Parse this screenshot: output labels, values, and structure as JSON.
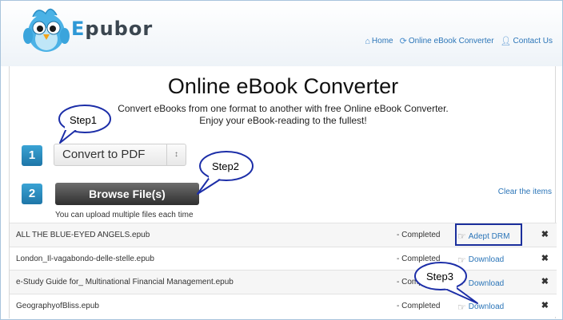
{
  "header": {
    "logo_text_first": "E",
    "logo_text_rest": "pubor",
    "nav": [
      {
        "label": "Home",
        "icon": "home-icon"
      },
      {
        "label": "Online eBook Converter",
        "icon": "refresh-icon"
      },
      {
        "label": "Contact Us",
        "icon": "user-icon"
      }
    ]
  },
  "main": {
    "title": "Online eBook Converter",
    "subtitle_line1": "Convert eBooks from one format to another with free Online eBook Converter.",
    "subtitle_line2": "Enjoy your eBook-reading to the fullest!",
    "step1_number": "1",
    "step2_number": "2",
    "format_select_value": "Convert to PDF",
    "format_select_arrow": "↕",
    "browse_label": "Browse File(s)",
    "upload_note": "You can upload multiple files each time",
    "clear_label": "Clear the items"
  },
  "files": [
    {
      "name": "ALL THE BLUE-EYED ANGELS.epub",
      "status": "- Completed",
      "action": "Adept DRM",
      "remove": "✖"
    },
    {
      "name": "London_Il-vagabondo-delle-stelle.epub",
      "status": "- Completed",
      "action": "Download",
      "remove": "✖"
    },
    {
      "name": "e-Study Guide for_ Multinational Financial Management.epub",
      "status": "- Completed",
      "action": "Download",
      "remove": "✖"
    },
    {
      "name": "GeographyofBliss.epub",
      "status": "- Completed",
      "action": "Download",
      "remove": "✖"
    }
  ],
  "callouts": {
    "step1": "Step1",
    "step2": "Step2",
    "step3": "Step3"
  },
  "colors": {
    "accent": "#2e98d6",
    "link": "#2b75b8",
    "highlight_box": "#1b2f9c",
    "callout_stroke": "#1c2ea8"
  }
}
